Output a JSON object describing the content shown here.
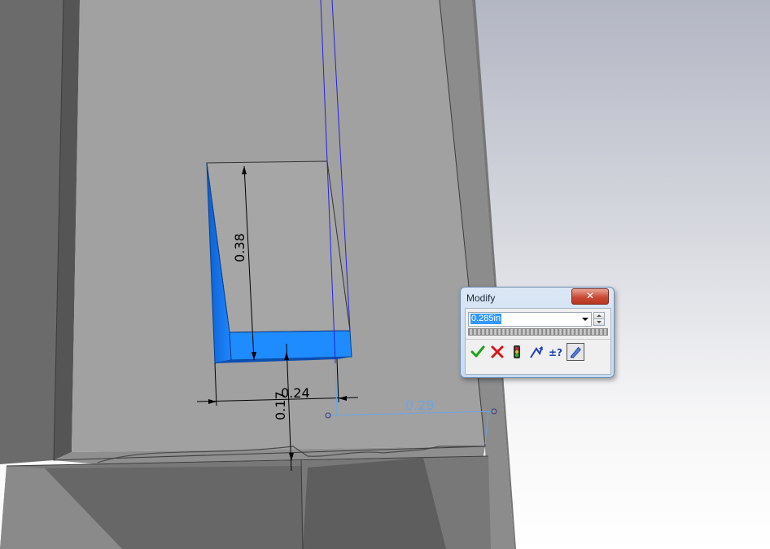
{
  "viewport": {
    "dimensions": {
      "d1": "0.38",
      "d2": "0.24",
      "d3": "0.17",
      "d4": "0.29"
    }
  },
  "modify_dialog": {
    "title": "Modify",
    "value": "0.285in",
    "buttons": [
      {
        "name": "ok",
        "icon": "check-icon"
      },
      {
        "name": "cancel",
        "icon": "x-icon"
      },
      {
        "name": "rebuild",
        "icon": "traffic-light-icon"
      },
      {
        "name": "reverse-sense",
        "icon": "arrow-icon"
      },
      {
        "name": "mark-for-drawing",
        "icon": "plus-minus-question-icon"
      },
      {
        "name": "options",
        "icon": "options-pen-icon"
      }
    ]
  },
  "colors": {
    "background_white": "#ffffff",
    "background_gray": "#b5b9c6",
    "part_face": "#a0a0a0",
    "selected_face": "#1a86ff",
    "sketch_line": "#2b2bd9",
    "dimension_blue": "#6aa5e8"
  }
}
